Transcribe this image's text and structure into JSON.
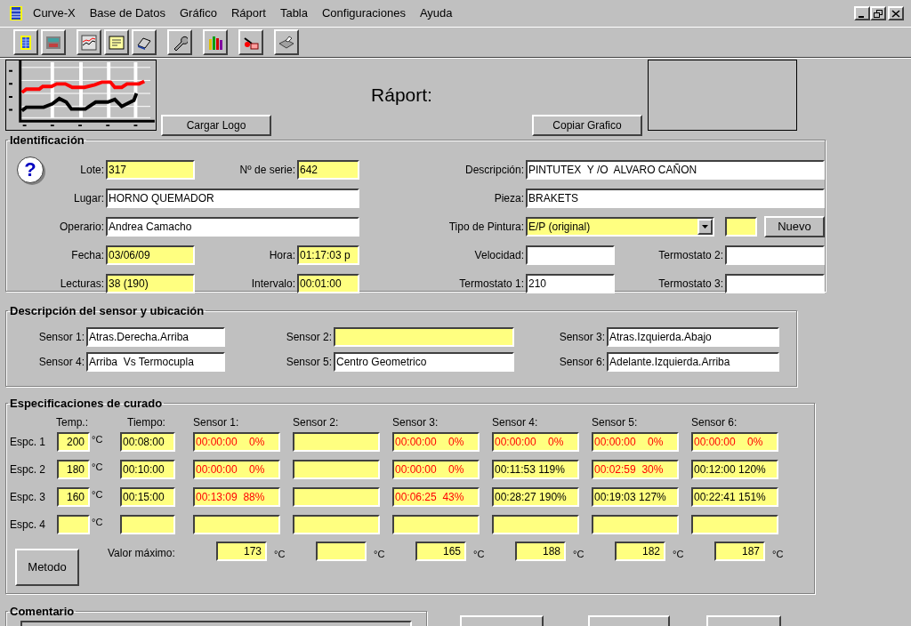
{
  "menu": [
    "Curve-X",
    "Base de Datos",
    "Gráfico",
    "Ráport",
    "Tabla",
    "Configuraciones",
    "Ayuda"
  ],
  "header": {
    "title": "Ráport:",
    "logo_button": "Cargar Logo",
    "copy_button": "Copiar Grafico"
  },
  "identification": {
    "title": "Identificación",
    "help_glyph": "?",
    "left_rows": [
      [
        {
          "label": "Lote:",
          "value": "317",
          "highlighted": true
        },
        {
          "label": "Nº de serie:",
          "value": "642",
          "highlighted": true
        }
      ],
      [
        {
          "label": "Lugar:",
          "value": "HORNO QUEMADOR",
          "highlighted": false
        }
      ],
      [
        {
          "label": "Operario:",
          "value": "Andrea Camacho",
          "highlighted": false
        }
      ],
      [
        {
          "label": "Fecha:",
          "value": "03/06/09",
          "highlighted": true
        },
        {
          "label": "Hora:",
          "value": "01:17:03 p",
          "highlighted": true
        }
      ],
      [
        {
          "label": "Lecturas:",
          "value": "38 (190)",
          "highlighted": true
        },
        {
          "label": "Intervalo:",
          "value": "00:01:00",
          "highlighted": true
        }
      ]
    ],
    "right_rows": [
      [
        {
          "kind": "text",
          "label": "Descripción:",
          "value": "PINTUTEX  Y /O  ALVARO CAÑON",
          "highlighted": false
        }
      ],
      [
        {
          "kind": "text",
          "label": "Pieza:",
          "value": "BRAKETS",
          "highlighted": false
        }
      ],
      [
        {
          "kind": "combo",
          "label": "Tipo de Pintura:",
          "value": "E/P (original)",
          "highlighted": true
        },
        {
          "kind": "small",
          "highlighted": true
        },
        {
          "kind": "button",
          "label": "Nuevo"
        }
      ],
      [
        {
          "kind": "text",
          "label": "Velocidad:",
          "highlighted": false
        },
        {
          "kind": "text",
          "label": "Termostato 2:",
          "highlighted": false
        }
      ],
      [
        {
          "kind": "text",
          "label": "Termostato 1:",
          "value": "210",
          "highlighted": false
        },
        {
          "kind": "text",
          "label": "Termostato 3:",
          "highlighted": false
        }
      ]
    ]
  },
  "sensors": {
    "title": "Descripción del sensor y ubicación",
    "rows": [
      [
        {
          "label": "Sensor 1:",
          "value": "Atras.Derecha.Arriba",
          "highlighted": false
        },
        {
          "label": "Sensor 2:",
          "highlighted": true
        },
        {
          "label": "Sensor 3:",
          "value": "Atras.Izquierda.Abajo",
          "highlighted": false
        }
      ],
      [
        {
          "label": "Sensor 4:",
          "value": "Arriba  Vs Termocupla",
          "highlighted": false
        },
        {
          "label": "Sensor 5:",
          "value": "Centro Geometrico",
          "highlighted": false
        },
        {
          "label": "Sensor 6:",
          "value": "Adelante.Izquierda.Arriba",
          "highlighted": false
        }
      ]
    ]
  },
  "curing": {
    "title": "Especificaciones de curado",
    "columns": [
      "Temp.:",
      "Tiempo:",
      "Sensor 1:",
      "Sensor 2:",
      "Sensor 3:",
      "Sensor 4:",
      "Sensor 5:",
      "Sensor 6:"
    ],
    "rows": [
      {
        "label": "Espc. 1",
        "temp": "200",
        "unit": "°C",
        "time": "00:08:00",
        "sensors": [
          {
            "kind": "reading",
            "value": "00:00:00    0%",
            "alert": true
          },
          {
            "kind": "empty"
          },
          {
            "kind": "reading",
            "value": "00:00:00    0%",
            "alert": true
          },
          {
            "kind": "reading",
            "value": "00:00:00    0%",
            "alert": true
          },
          {
            "kind": "reading",
            "value": "00:00:00    0%",
            "alert": true
          },
          {
            "kind": "reading",
            "value": "00:00:00    0%",
            "alert": true
          }
        ]
      },
      {
        "label": "Espc. 2",
        "temp": "180",
        "unit": "°C",
        "time": "00:10:00",
        "sensors": [
          {
            "kind": "reading",
            "value": "00:00:00    0%",
            "alert": true
          },
          {
            "kind": "empty"
          },
          {
            "kind": "reading",
            "value": "00:00:00    0%",
            "alert": true
          },
          {
            "kind": "reading",
            "value": "00:11:53 119%",
            "alert": false
          },
          {
            "kind": "reading",
            "value": "00:02:59  30%",
            "alert": true
          },
          {
            "kind": "reading",
            "value": "00:12:00 120%",
            "alert": false
          }
        ]
      },
      {
        "label": "Espc. 3",
        "temp": "160",
        "unit": "°C",
        "time": "00:15:00",
        "sensors": [
          {
            "kind": "reading",
            "value": "00:13:09  88%",
            "alert": true
          },
          {
            "kind": "empty"
          },
          {
            "kind": "reading",
            "value": "00:06:25  43%",
            "alert": true
          },
          {
            "kind": "reading",
            "value": "00:28:27 190%",
            "alert": false
          },
          {
            "kind": "reading",
            "value": "00:19:03 127%",
            "alert": false
          },
          {
            "kind": "reading",
            "value": "00:22:41 151%",
            "alert": false
          }
        ]
      },
      {
        "label": "Espc. 4",
        "unit": "°C",
        "sensors": [
          {
            "kind": "empty"
          },
          {
            "kind": "empty"
          },
          {
            "kind": "empty"
          },
          {
            "kind": "empty"
          },
          {
            "kind": "empty"
          },
          {
            "kind": "empty"
          }
        ]
      }
    ],
    "max_label": "Valor máximo:",
    "max_values": [
      {
        "value": "173",
        "unit": "°C"
      },
      {
        "unit": "°C"
      },
      {
        "value": "165",
        "unit": "°C"
      },
      {
        "value": "188",
        "unit": "°C"
      },
      {
        "value": "182",
        "unit": "°C"
      },
      {
        "value": "187",
        "unit": "°C"
      }
    ],
    "method_button": "Metodo"
  },
  "comment": {
    "title": "Comentario"
  }
}
